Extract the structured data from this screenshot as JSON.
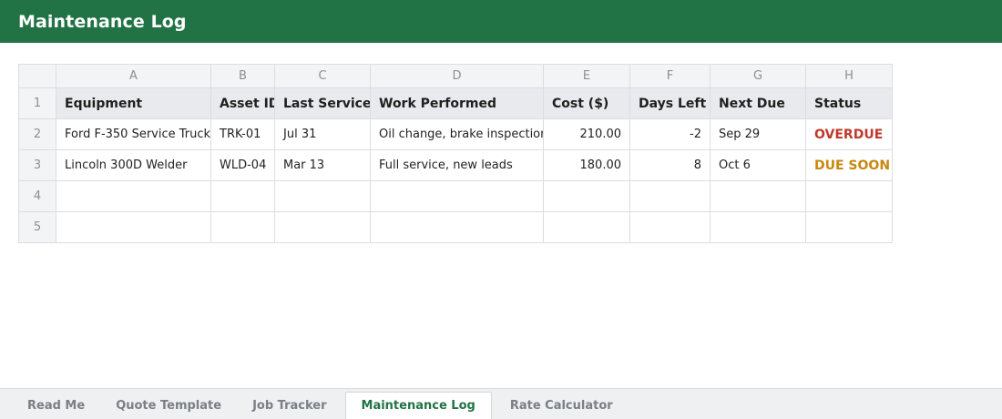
{
  "app": {
    "title": "Maintenance Log"
  },
  "columns": [
    "A",
    "B",
    "C",
    "D",
    "E",
    "F",
    "G",
    "H"
  ],
  "rows": [
    "1",
    "2",
    "3",
    "4",
    "5"
  ],
  "headers": [
    "Equipment",
    "Asset ID",
    "Last Serviced",
    "Work Performed",
    "Cost ($)",
    "Days Left",
    "Next Due",
    "Status"
  ],
  "records": [
    {
      "equipment": "Ford F-350 Service Truck",
      "asset_id": "TRK-01",
      "last_serviced": "Jul 31",
      "work": "Oil change, brake inspection",
      "cost": "210.00",
      "days_left": "-2",
      "next_due": "Sep 29",
      "status": "OVERDUE"
    },
    {
      "equipment": "Lincoln 300D Welder",
      "asset_id": "WLD-04",
      "last_serviced": "Mar 13",
      "work": "Full service, new leads",
      "cost": "180.00",
      "days_left": "8",
      "next_due": "Oct 6",
      "status": "DUE SOON"
    }
  ],
  "tabs": [
    {
      "label": "Read Me",
      "active": false
    },
    {
      "label": "Quote Template",
      "active": false
    },
    {
      "label": "Job Tracker",
      "active": false
    },
    {
      "label": "Maintenance Log",
      "active": true
    },
    {
      "label": "Rate Calculator",
      "active": false
    }
  ],
  "colors": {
    "brand": "#217346",
    "overdue": "#c0392b",
    "due_soon": "#c8870e"
  }
}
